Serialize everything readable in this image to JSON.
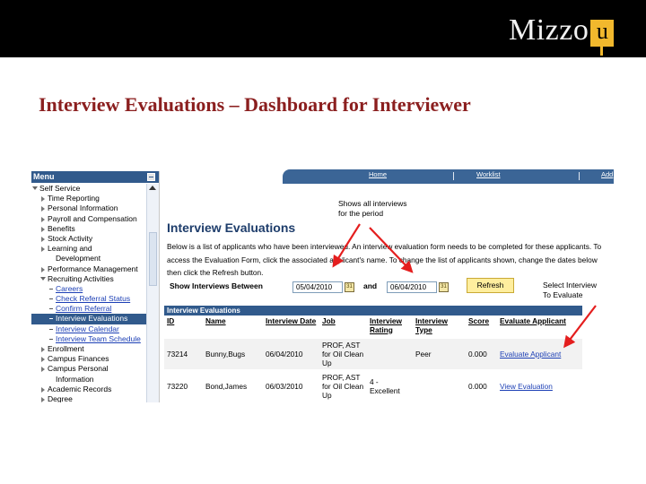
{
  "slide": {
    "logo_text": "Mizzo",
    "logo_badge": "u",
    "title": "Interview Evaluations – Dashboard for Interviewer"
  },
  "menu": {
    "title": "Menu",
    "items": [
      {
        "label": "Self Service",
        "level": 0,
        "state": "expanded"
      },
      {
        "label": "Time Reporting",
        "level": 1,
        "state": "collapsed"
      },
      {
        "label": "Personal Information",
        "level": 1,
        "state": "collapsed"
      },
      {
        "label": "Payroll and Compensation",
        "level": 1,
        "state": "collapsed"
      },
      {
        "label": "Benefits",
        "level": 1,
        "state": "collapsed"
      },
      {
        "label": "Stock Activity",
        "level": 1,
        "state": "collapsed"
      },
      {
        "label": "Learning and",
        "level": 1,
        "state": "collapsed"
      },
      {
        "label": "Development",
        "level": 1,
        "state": "continuation"
      },
      {
        "label": "Performance Management",
        "level": 1,
        "state": "collapsed"
      },
      {
        "label": "Recruiting Activities",
        "level": 1,
        "state": "expanded"
      },
      {
        "label": "Careers",
        "level": 2,
        "state": "link"
      },
      {
        "label": "Check Referral Status",
        "level": 2,
        "state": "link"
      },
      {
        "label": "Confirm Referral",
        "level": 2,
        "state": "link"
      },
      {
        "label": "Interview Evaluations",
        "level": 2,
        "state": "active"
      },
      {
        "label": "Interview Calendar",
        "level": 2,
        "state": "link"
      },
      {
        "label": "Interview Team Schedule",
        "level": 2,
        "state": "link"
      },
      {
        "label": "Enrollment",
        "level": 1,
        "state": "collapsed"
      },
      {
        "label": "Campus Finances",
        "level": 1,
        "state": "collapsed"
      },
      {
        "label": "Campus Personal",
        "level": 1,
        "state": "collapsed"
      },
      {
        "label": "Information",
        "level": 1,
        "state": "continuation"
      },
      {
        "label": "Academic Records",
        "level": 1,
        "state": "collapsed"
      },
      {
        "label": "Degree",
        "level": 1,
        "state": "collapsed"
      }
    ]
  },
  "nav": {
    "home": "Home",
    "worklist": "Worklist",
    "add": "Add"
  },
  "page": {
    "title": "Interview Evaluations",
    "description": "Below is a list of applicants who have been interviewed. An interview evaluation form needs to be completed for these applicants. To access the Evaluation Form, click the associated applicant's name.  To change the list of applicants shown, change the dates below then click the Refresh button."
  },
  "filter": {
    "label": "Show Interviews Between",
    "from_date": "05/04/2010",
    "and_label": "and",
    "to_date": "06/04/2010",
    "calendar_glyph": "31",
    "refresh_label": "Refresh"
  },
  "grid": {
    "title": "Interview Evaluations",
    "columns": [
      "ID",
      "Name",
      "Interview Date",
      "Job",
      "Interview Rating",
      "Interview Type",
      "Score",
      "Evaluate Applicant"
    ],
    "rows": [
      {
        "id": "73214",
        "name": "Bunny,Bugs",
        "date": "06/04/2010",
        "job": "PROF, AST for Oil Clean Up",
        "rating": "",
        "type": "Peer",
        "score": "0.000",
        "action": "Evaluate Applicant"
      },
      {
        "id": "73220",
        "name": "Bond,James",
        "date": "06/03/2010",
        "job": "PROF, AST for Oil Clean Up",
        "rating": "4 - Excellent",
        "type": "",
        "score": "0.000",
        "action": "View Evaluation"
      }
    ]
  },
  "annotations": {
    "shows_all": "Shows all interviews\nfor the period",
    "select_interview": "Select Interview\nTo Evaluate"
  },
  "colors": {
    "slide_title": "#8b1f1f",
    "header_blue": "#315a8c",
    "link_blue": "#1c3fb5",
    "arrow_red": "#e41e1e",
    "button_yellow": "#ffee9e",
    "logo_gold": "#f1b82d"
  }
}
